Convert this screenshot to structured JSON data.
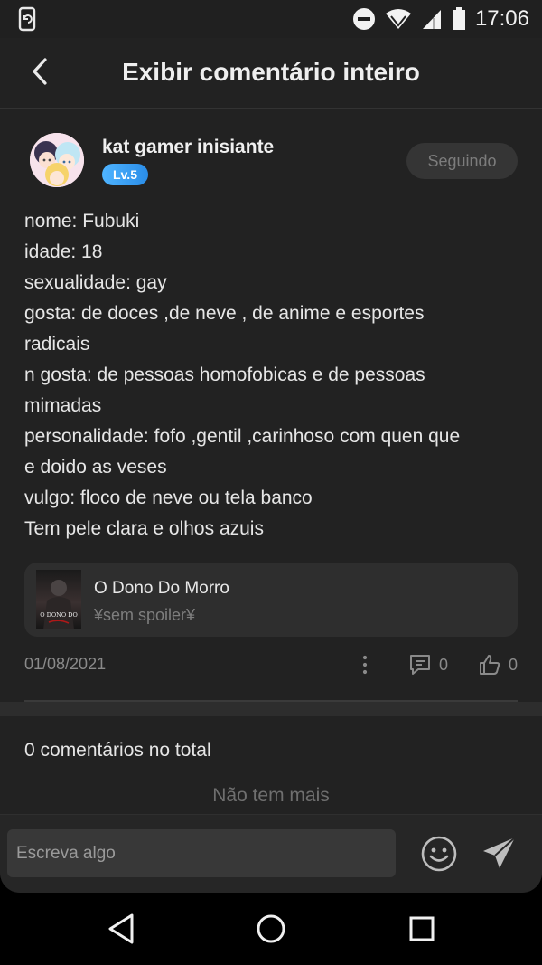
{
  "status_bar": {
    "time": "17:06",
    "icons": [
      "screen-rotate-icon",
      "do-not-disturb-icon",
      "wifi-icon",
      "signal-icon",
      "battery-icon"
    ]
  },
  "header": {
    "title": "Exibir comentário inteiro",
    "back_icon": "back-arrow-icon"
  },
  "author": {
    "name": "kat gamer inisiante",
    "level": "Lv.5",
    "follow_label": "Seguindo"
  },
  "comment": {
    "lines": [
      "nome: Fubuki",
      "idade: 18",
      "sexualidade: gay",
      "gosta: de doces ,de neve , de anime e esportes",
      "radicais",
      "n gosta: de pessoas homofobicas e de pessoas",
      "mimadas",
      "personalidade: fofo ,gentil ,carinhoso com quen que",
      "e doido as veses",
      "vulgo: floco de neve ou tela banco",
      "Tem pele clara e olhos azuis"
    ]
  },
  "story": {
    "title": "O Dono Do Morro",
    "subtitle": "¥sem spoiler¥",
    "cover_text": "O DONO DO"
  },
  "meta": {
    "date": "01/08/2021",
    "replies": "0",
    "likes": "0"
  },
  "comments_section": {
    "total": "0 comentários no total",
    "no_more": "Não tem mais"
  },
  "input": {
    "placeholder": "Escreva algo"
  },
  "colors": {
    "background": "#222222",
    "badge": "#3a9cf5",
    "muted": "#8a8a8a"
  }
}
